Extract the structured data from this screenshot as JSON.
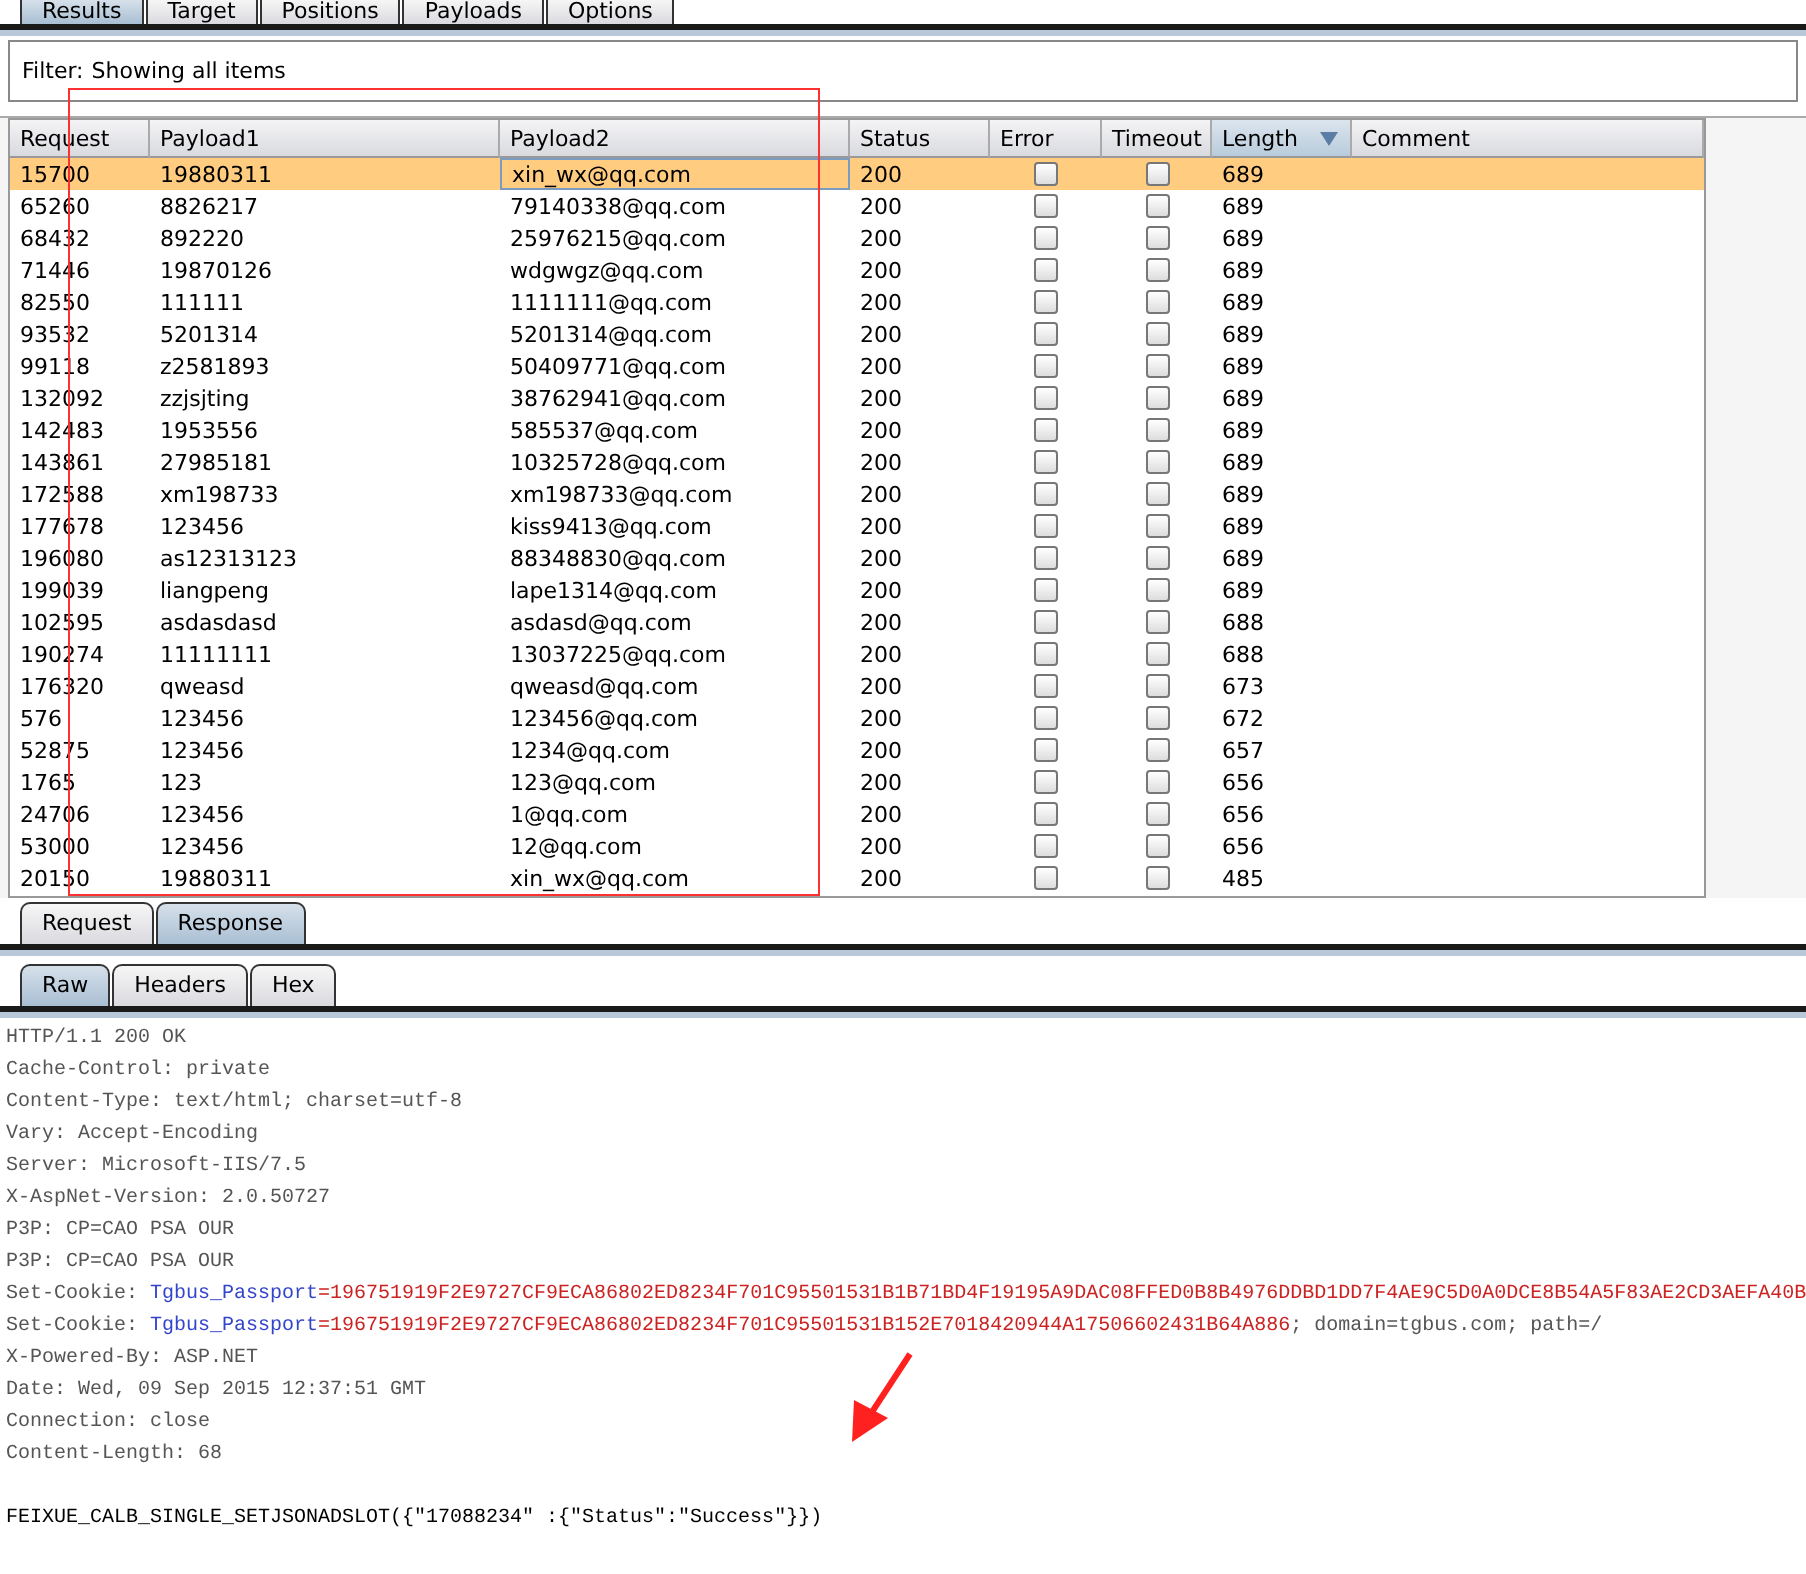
{
  "top_tabs": [
    {
      "label": "Results",
      "selected": true
    },
    {
      "label": "Target",
      "selected": false
    },
    {
      "label": "Positions",
      "selected": false
    },
    {
      "label": "Payloads",
      "selected": false
    },
    {
      "label": "Options",
      "selected": false
    }
  ],
  "filter": {
    "label": "Filter:",
    "value": "Showing all items"
  },
  "table": {
    "columns": [
      {
        "label": "Request",
        "kind": "text",
        "sorted": false
      },
      {
        "label": "Payload1",
        "kind": "text",
        "sorted": false
      },
      {
        "label": "Payload2",
        "kind": "text",
        "sorted": false
      },
      {
        "label": "Status",
        "kind": "text",
        "sorted": false
      },
      {
        "label": "Error",
        "kind": "check",
        "sorted": false
      },
      {
        "label": "Timeout",
        "kind": "check",
        "sorted": false
      },
      {
        "label": "Length",
        "kind": "text",
        "sorted": true
      },
      {
        "label": "Comment",
        "kind": "text",
        "sorted": false
      }
    ],
    "rows": [
      {
        "selected": true,
        "request": "15700",
        "payload1": "19880311",
        "payload2": "xin_wx@qq.com",
        "status": "200",
        "error": false,
        "timeout": false,
        "length": "689"
      },
      {
        "selected": false,
        "request": "65260",
        "payload1": "8826217",
        "payload2": "79140338@qq.com",
        "status": "200",
        "error": false,
        "timeout": false,
        "length": "689"
      },
      {
        "selected": false,
        "request": "68432",
        "payload1": "892220",
        "payload2": "25976215@qq.com",
        "status": "200",
        "error": false,
        "timeout": false,
        "length": "689"
      },
      {
        "selected": false,
        "request": "71446",
        "payload1": "19870126",
        "payload2": "wdgwgz@qq.com",
        "status": "200",
        "error": false,
        "timeout": false,
        "length": "689"
      },
      {
        "selected": false,
        "request": "82550",
        "payload1": "111111",
        "payload2": "1111111@qq.com",
        "status": "200",
        "error": false,
        "timeout": false,
        "length": "689"
      },
      {
        "selected": false,
        "request": "93532",
        "payload1": "5201314",
        "payload2": "5201314@qq.com",
        "status": "200",
        "error": false,
        "timeout": false,
        "length": "689"
      },
      {
        "selected": false,
        "request": "99118",
        "payload1": "z2581893",
        "payload2": "50409771@qq.com",
        "status": "200",
        "error": false,
        "timeout": false,
        "length": "689"
      },
      {
        "selected": false,
        "request": "132092",
        "payload1": "zzjsjting",
        "payload2": "38762941@qq.com",
        "status": "200",
        "error": false,
        "timeout": false,
        "length": "689"
      },
      {
        "selected": false,
        "request": "142483",
        "payload1": "1953556",
        "payload2": "585537@qq.com",
        "status": "200",
        "error": false,
        "timeout": false,
        "length": "689"
      },
      {
        "selected": false,
        "request": "143861",
        "payload1": "27985181",
        "payload2": "10325728@qq.com",
        "status": "200",
        "error": false,
        "timeout": false,
        "length": "689"
      },
      {
        "selected": false,
        "request": "172588",
        "payload1": "xm198733",
        "payload2": "xm198733@qq.com",
        "status": "200",
        "error": false,
        "timeout": false,
        "length": "689"
      },
      {
        "selected": false,
        "request": "177678",
        "payload1": "123456",
        "payload2": "kiss9413@qq.com",
        "status": "200",
        "error": false,
        "timeout": false,
        "length": "689"
      },
      {
        "selected": false,
        "request": "196080",
        "payload1": "as12313123",
        "payload2": "88348830@qq.com",
        "status": "200",
        "error": false,
        "timeout": false,
        "length": "689"
      },
      {
        "selected": false,
        "request": "199039",
        "payload1": "liangpeng",
        "payload2": "lape1314@qq.com",
        "status": "200",
        "error": false,
        "timeout": false,
        "length": "689"
      },
      {
        "selected": false,
        "request": "102595",
        "payload1": "asdasdasd",
        "payload2": "asdasd@qq.com",
        "status": "200",
        "error": false,
        "timeout": false,
        "length": "688"
      },
      {
        "selected": false,
        "request": "190274",
        "payload1": "11111111",
        "payload2": "13037225@qq.com",
        "status": "200",
        "error": false,
        "timeout": false,
        "length": "688"
      },
      {
        "selected": false,
        "request": "176320",
        "payload1": "qweasd",
        "payload2": "qweasd@qq.com",
        "status": "200",
        "error": false,
        "timeout": false,
        "length": "673"
      },
      {
        "selected": false,
        "request": "576",
        "payload1": "123456",
        "payload2": "123456@qq.com",
        "status": "200",
        "error": false,
        "timeout": false,
        "length": "672"
      },
      {
        "selected": false,
        "request": "52875",
        "payload1": "123456",
        "payload2": "1234@qq.com",
        "status": "200",
        "error": false,
        "timeout": false,
        "length": "657"
      },
      {
        "selected": false,
        "request": "1765",
        "payload1": "123",
        "payload2": "123@qq.com",
        "status": "200",
        "error": false,
        "timeout": false,
        "length": "656"
      },
      {
        "selected": false,
        "request": "24706",
        "payload1": "123456",
        "payload2": "1@qq.com",
        "status": "200",
        "error": false,
        "timeout": false,
        "length": "656"
      },
      {
        "selected": false,
        "request": "53000",
        "payload1": "123456",
        "payload2": "12@qq.com",
        "status": "200",
        "error": false,
        "timeout": false,
        "length": "656"
      },
      {
        "selected": false,
        "request": "20150",
        "payload1": "19880311",
        "payload2": "xin_wx@qq.com",
        "status": "200",
        "error": false,
        "timeout": false,
        "length": "485"
      }
    ]
  },
  "message_tabs": [
    {
      "label": "Request",
      "selected": false
    },
    {
      "label": "Response",
      "selected": true
    }
  ],
  "view_tabs": [
    {
      "label": "Raw",
      "selected": true
    },
    {
      "label": "Headers",
      "selected": false
    },
    {
      "label": "Hex",
      "selected": false
    }
  ],
  "response_lines": [
    {
      "kind": "header",
      "segments": [
        {
          "kind": "plain",
          "text": "HTTP/1.1 200 OK"
        }
      ]
    },
    {
      "kind": "header",
      "segments": [
        {
          "kind": "plain",
          "text": "Cache-Control: private"
        }
      ]
    },
    {
      "kind": "header",
      "segments": [
        {
          "kind": "plain",
          "text": "Content-Type: text/html; charset=utf-8"
        }
      ]
    },
    {
      "kind": "header",
      "segments": [
        {
          "kind": "plain",
          "text": "Vary: Accept-Encoding"
        }
      ]
    },
    {
      "kind": "header",
      "segments": [
        {
          "kind": "plain",
          "text": "Server: Microsoft-IIS/7.5"
        }
      ]
    },
    {
      "kind": "header",
      "segments": [
        {
          "kind": "plain",
          "text": "X-AspNet-Version: 2.0.50727"
        }
      ]
    },
    {
      "kind": "header",
      "segments": [
        {
          "kind": "plain",
          "text": "P3P: CP=CAO PSA OUR"
        }
      ]
    },
    {
      "kind": "header",
      "segments": [
        {
          "kind": "plain",
          "text": "P3P: CP=CAO PSA OUR"
        }
      ]
    },
    {
      "kind": "header",
      "segments": [
        {
          "kind": "plain",
          "text": "Set-Cookie: "
        },
        {
          "kind": "name",
          "text": "Tgbus_Passport"
        },
        {
          "kind": "value",
          "text": "=196751919F2E9727CF9ECA86802ED8234F701C95501531B1B71BD4F19195A9DAC08FFED0B8B4976DDBD1DD7F4AE9C5D0A0DCE8B54A5F83AE2CD3AEFA40B"
        }
      ]
    },
    {
      "kind": "header",
      "segments": [
        {
          "kind": "plain",
          "text": "Set-Cookie: "
        },
        {
          "kind": "name",
          "text": "Tgbus_Passport"
        },
        {
          "kind": "value",
          "text": "=196751919F2E9727CF9ECA86802ED8234F701C95501531B152E7018420944A17506602431B64A886"
        },
        {
          "kind": "plain",
          "text": "; domain=tgbus.com; path=/"
        }
      ]
    },
    {
      "kind": "header",
      "segments": [
        {
          "kind": "plain",
          "text": "X-Powered-By: ASP.NET"
        }
      ]
    },
    {
      "kind": "header",
      "segments": [
        {
          "kind": "plain",
          "text": "Date: Wed, 09 Sep 2015 12:37:51 GMT"
        }
      ]
    },
    {
      "kind": "header",
      "segments": [
        {
          "kind": "plain",
          "text": "Connection: close"
        }
      ]
    },
    {
      "kind": "header",
      "segments": [
        {
          "kind": "plain",
          "text": "Content-Length: 68"
        }
      ]
    },
    {
      "kind": "blank"
    },
    {
      "kind": "body",
      "segments": [
        {
          "kind": "plain",
          "text": "FEIXUE_CALB_SINGLE_SETJSONADSLOT({\"17088234\" :{\"Status\":\"Success\"}})"
        }
      ]
    }
  ]
}
